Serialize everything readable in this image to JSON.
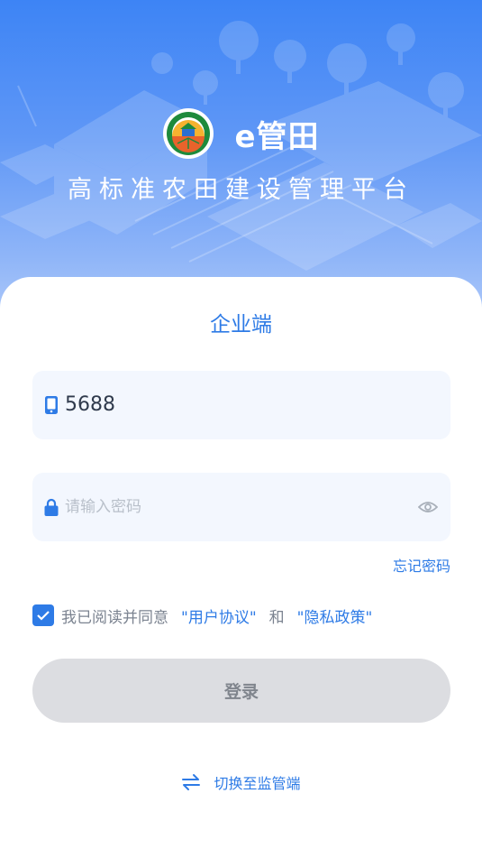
{
  "header": {
    "app_name": "e管田",
    "subtitle": "高标准农田建设管理平台"
  },
  "login": {
    "portal_title": "企业端",
    "phone_value": "5688",
    "password_placeholder": "请输入密码",
    "forgot_label": "忘记密码",
    "agree_prefix": "我已阅读并同意",
    "user_agreement": "\"用户协议\"",
    "and_text": "和",
    "privacy_policy": "\"隐私政策\"",
    "agreement_checked": true,
    "login_button": "登录",
    "switch_label": "切换至监管端"
  },
  "colors": {
    "accent": "#2e7be6",
    "hero_top": "#3d84f5",
    "field_bg": "#f3f7fe",
    "button_disabled": "#dcdde1"
  },
  "icons": {
    "logo": "farmland-seal-logo",
    "phone": "phone-icon",
    "lock": "lock-icon",
    "eye": "eye-icon",
    "check": "check-icon",
    "switch": "swap-icon"
  }
}
